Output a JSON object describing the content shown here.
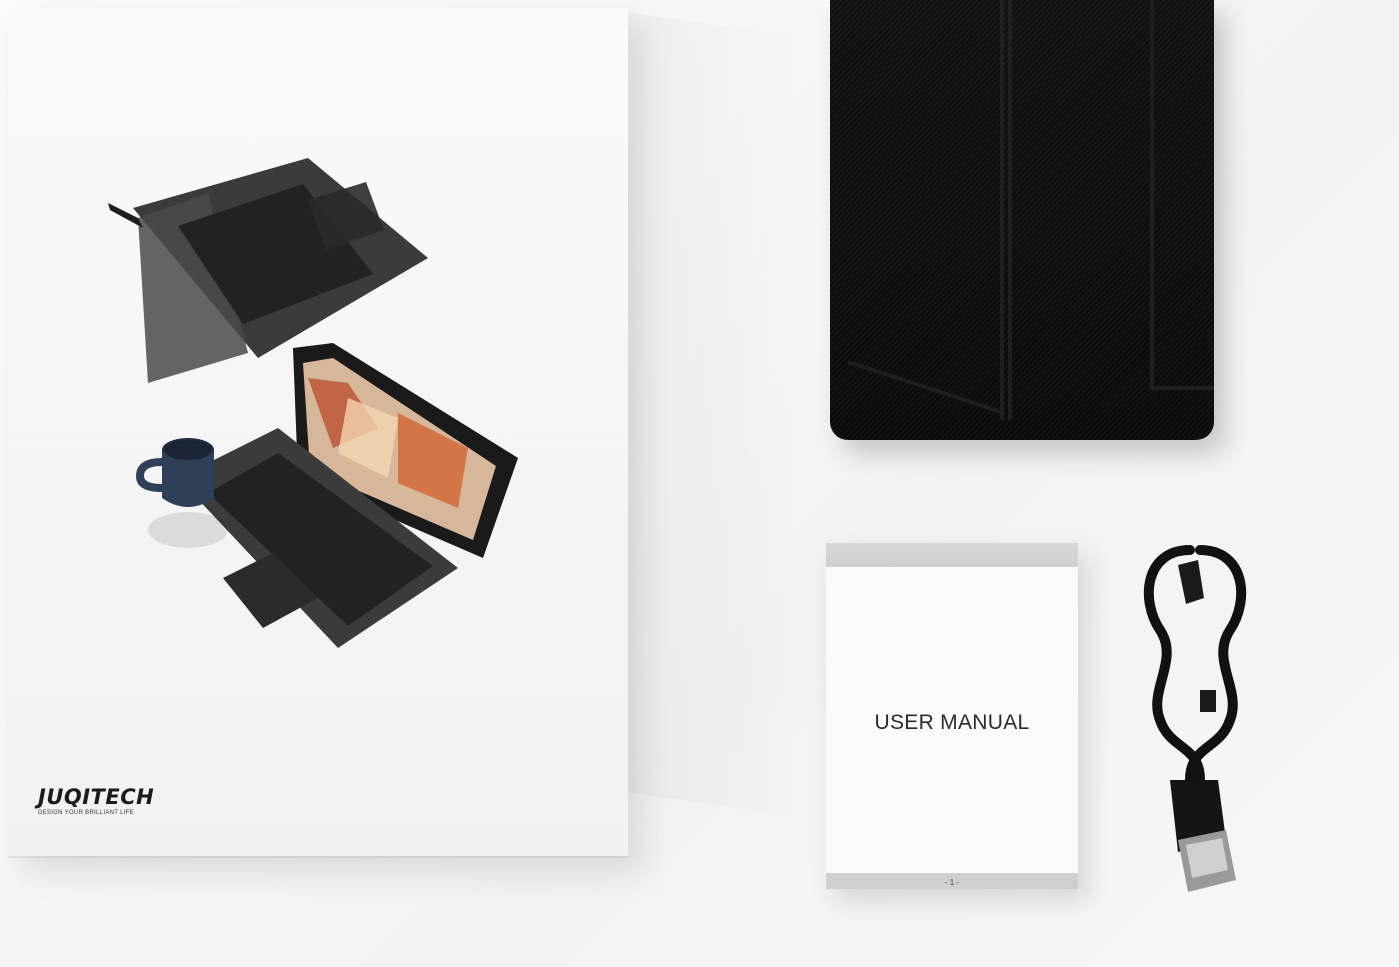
{
  "box": {
    "brand_name": "JUQITECH",
    "brand_tagline": "DESIGN YOUR BRILLIANT LIFE"
  },
  "manual": {
    "title": "USER MANUAL",
    "page": "- 1 -"
  },
  "icons": {
    "cable": "usb-cable-icon",
    "mug": "mug-icon",
    "laptop": "keyboard-case-icon"
  },
  "colors": {
    "case": "#0e0e0e",
    "keyboard": "#3a3a3a",
    "mug": "#2e3f57"
  }
}
